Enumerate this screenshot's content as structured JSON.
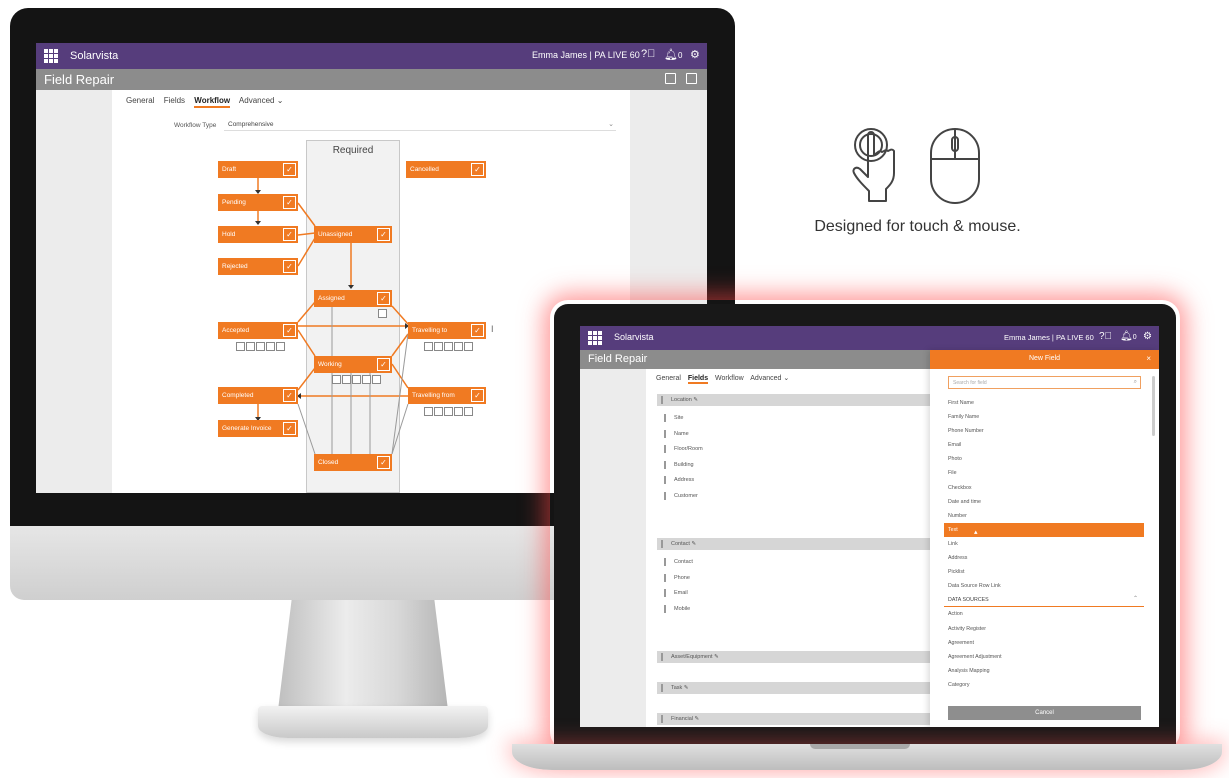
{
  "desktop": {
    "brand": "Solarvista",
    "user": "Emma James | PA LIVE 60",
    "notif_count": "0",
    "page_title": "Field Repair",
    "tabs": [
      {
        "label": "General",
        "active": false
      },
      {
        "label": "Fields",
        "active": false
      },
      {
        "label": "Workflow",
        "active": true
      },
      {
        "label": "Advanced ⌄",
        "active": false
      }
    ],
    "workflow_type_label": "Workflow Type",
    "workflow_type_value": "Comprehensive",
    "required_label": "Required",
    "nodes": {
      "draft": "Draft",
      "pending": "Pending",
      "hold": "Hold",
      "rejected": "Rejected",
      "accepted": "Accepted",
      "completed": "Completed",
      "generate_invoice": "Generate Invoice",
      "unassigned": "Unassigned",
      "assigned": "Assigned",
      "working": "Working",
      "closed": "Closed",
      "cancelled": "Cancelled",
      "travelling_to": "Travelling to",
      "travelling_from": "Travelling from"
    },
    "check_glyph": "✓"
  },
  "tagline": "Designed for touch & mouse.",
  "laptop": {
    "brand": "Solarvista",
    "user": "Emma James | PA LIVE 60",
    "notif_count": "0",
    "page_title": "Field Repair",
    "tabs": [
      {
        "label": "General",
        "active": false
      },
      {
        "label": "Fields",
        "active": true
      },
      {
        "label": "Workflow",
        "active": false
      },
      {
        "label": "Advanced ⌄",
        "active": false
      }
    ],
    "sections": {
      "location": {
        "title": "Location",
        "fields": [
          "Site",
          "Name",
          "Floor/Room",
          "Building",
          "Address",
          "Customer"
        ]
      },
      "contact": {
        "title": "Contact",
        "fields": [
          "Contact",
          "Phone",
          "Email",
          "Mobile"
        ]
      },
      "asset": {
        "title": "Asset/Equipment"
      },
      "task": {
        "title": "Task"
      },
      "financial": {
        "title": "Financial"
      }
    },
    "new_field_panel": {
      "title": "New Field",
      "close": "×",
      "search_placeholder": "Search for field",
      "items": [
        "First Name",
        "Family Name",
        "Phone Number",
        "Email",
        "Photo",
        "File",
        "Checkbox",
        "Date and time",
        "Number",
        "Text",
        "Link",
        "Address",
        "Picklist",
        "Data Source Row Link"
      ],
      "selected_item": "Text",
      "data_sources_label": "DATA SOURCES",
      "data_sources": [
        "Action",
        "Activity Register",
        "Agreement",
        "Agreement Adjustment",
        "Analysis Mapping",
        "Category"
      ],
      "cancel_label": "Cancel"
    }
  },
  "colors": {
    "topbar": "#563d7c",
    "accent_orange": "#f07a22",
    "subbar_gray": "#8c8c8c"
  }
}
